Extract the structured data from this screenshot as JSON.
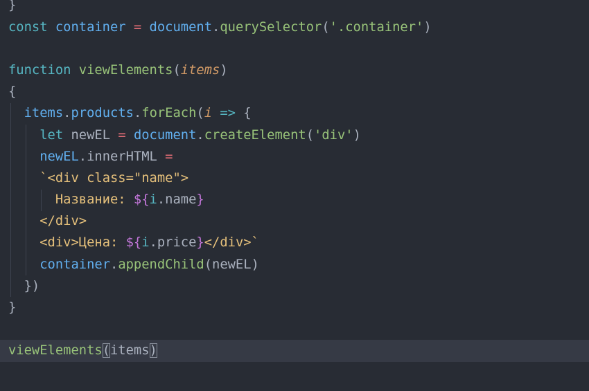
{
  "editor": {
    "current_line": 16,
    "lines": [
      [
        [
          "}",
          "punc"
        ]
      ],
      [
        [
          "const ",
          "kw"
        ],
        [
          "container ",
          "var"
        ],
        [
          "= ",
          "op"
        ],
        [
          "document",
          "var"
        ],
        [
          ".",
          "punc"
        ],
        [
          "querySelector",
          "fn"
        ],
        [
          "(",
          "punc"
        ],
        [
          "'.container'",
          "str"
        ],
        [
          ")",
          "punc"
        ]
      ],
      [],
      [
        [
          "function ",
          "kw"
        ],
        [
          "viewElements",
          "fn"
        ],
        [
          "(",
          "punc"
        ],
        [
          "items",
          "param"
        ],
        [
          ")",
          "punc"
        ]
      ],
      [
        [
          "{",
          "punc"
        ]
      ],
      [
        [
          "  ",
          "punc"
        ],
        [
          "items",
          "var"
        ],
        [
          ".",
          "punc"
        ],
        [
          "products",
          "var"
        ],
        [
          ".",
          "punc"
        ],
        [
          "forEach",
          "fn"
        ],
        [
          "(",
          "punc"
        ],
        [
          "i",
          "param"
        ],
        [
          " => ",
          "kw"
        ],
        [
          "{",
          "punc"
        ]
      ],
      [
        [
          "    ",
          "punc"
        ],
        [
          "let ",
          "kw"
        ],
        [
          "newEL ",
          "prop"
        ],
        [
          "= ",
          "op"
        ],
        [
          "document",
          "var"
        ],
        [
          ".",
          "punc"
        ],
        [
          "createElement",
          "fn"
        ],
        [
          "(",
          "punc"
        ],
        [
          "'div'",
          "str"
        ],
        [
          ")",
          "punc"
        ]
      ],
      [
        [
          "    ",
          "punc"
        ],
        [
          "newEL",
          "var"
        ],
        [
          ".",
          "punc"
        ],
        [
          "innerHTML ",
          "prop"
        ],
        [
          "=",
          "op"
        ]
      ],
      [
        [
          "    ",
          "punc"
        ],
        [
          "`<div class=\"name\">",
          "tpl"
        ]
      ],
      [
        [
          "      ",
          "punc"
        ],
        [
          "Название: ",
          "tpl"
        ],
        [
          "${",
          "interp"
        ],
        [
          "i",
          "ivar"
        ],
        [
          ".name",
          "prop"
        ],
        [
          "}",
          "interp"
        ]
      ],
      [
        [
          "    ",
          "punc"
        ],
        [
          "</div>",
          "tpl"
        ]
      ],
      [
        [
          "    ",
          "punc"
        ],
        [
          "<div>Цена: ",
          "tpl"
        ],
        [
          "${",
          "interp"
        ],
        [
          "i",
          "ivar"
        ],
        [
          ".price",
          "prop"
        ],
        [
          "}",
          "interp"
        ],
        [
          "</div>`",
          "tpl"
        ]
      ],
      [
        [
          "    ",
          "punc"
        ],
        [
          "container",
          "var"
        ],
        [
          ".",
          "punc"
        ],
        [
          "appendChild",
          "fn"
        ],
        [
          "(",
          "punc"
        ],
        [
          "newEL",
          "prop"
        ],
        [
          ")",
          "punc"
        ]
      ],
      [
        [
          "  ",
          "punc"
        ],
        [
          "})",
          "punc"
        ]
      ],
      [
        [
          "}",
          "punc"
        ]
      ],
      [],
      [
        [
          "viewElements",
          "fn"
        ],
        [
          "(",
          "punc match"
        ],
        [
          "items",
          "prop"
        ],
        [
          ")",
          "punc match"
        ]
      ]
    ]
  }
}
